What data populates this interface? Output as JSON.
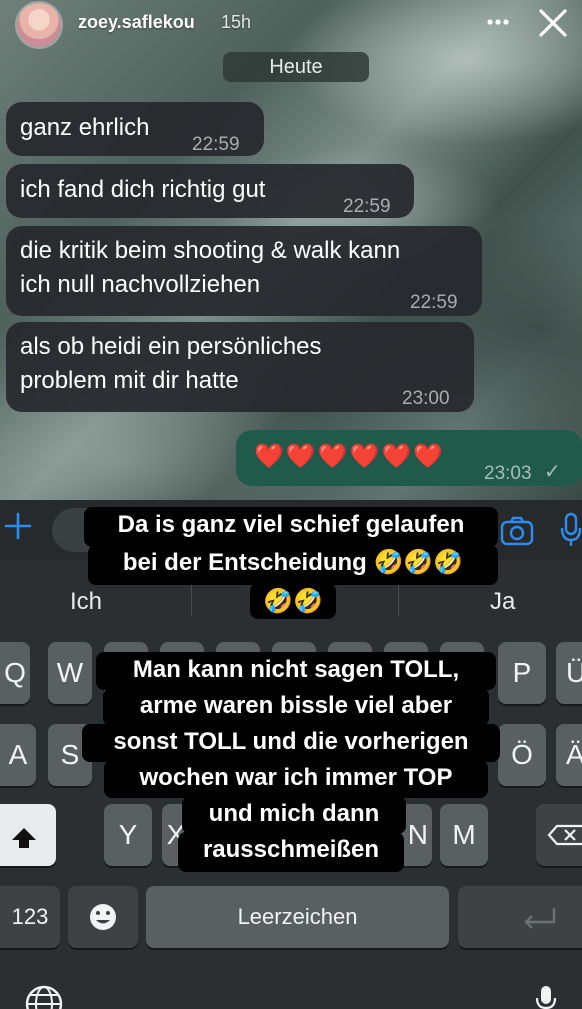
{
  "story": {
    "username": "zoey.saflekou",
    "time_ago": "15h",
    "more_icon": "more-horizontal-icon",
    "close_icon": "close-icon"
  },
  "chat": {
    "date_label": "Heute",
    "messages": [
      {
        "text": "ganz ehrlich",
        "time": "22:59"
      },
      {
        "text": "ich fand dich richtig gut",
        "time": "22:59"
      },
      {
        "text_line1": "die kritik beim shooting & walk kann",
        "text_line2": "ich null nachvollziehen",
        "time": "22:59"
      },
      {
        "text_line1": "als ob heidi ein persönliches",
        "text_line2": "problem mit dir hatte",
        "time": "23:00"
      },
      {
        "text": "❤️❤️❤️❤️❤️❤️",
        "time": "23:03",
        "status": "✓"
      }
    ]
  },
  "composer": {
    "plus_icon": "plus-icon",
    "camera_icon": "camera-icon",
    "mic_icon": "microphone-icon"
  },
  "keyboard": {
    "suggestions": [
      "Ich",
      "Ja"
    ],
    "row1": [
      "Q",
      "W",
      "P",
      "Ü"
    ],
    "row2": [
      "A",
      "S",
      "Ö",
      "Ä"
    ],
    "row3": [
      "Y",
      "X",
      "N",
      "M"
    ],
    "numbers_key": "123",
    "space_key": "Leerzeichen",
    "emoji_icon": "emoji-icon",
    "shift_icon": "shift-icon",
    "backspace_icon": "backspace-icon",
    "return_icon": "return-icon",
    "globe_icon": "globe-icon",
    "dictation_icon": "microphone-icon"
  },
  "captions": {
    "top_line1": "Da is ganz viel schief gelaufen",
    "top_line2": "bei der Entscheidung 🤣🤣🤣",
    "top_line3": "🤣🤣",
    "bottom_line1": "Man kann nicht sagen TOLL,",
    "bottom_line2": "arme waren bissle viel aber",
    "bottom_line3": "sonst TOLL und die vorherigen",
    "bottom_line4": "wochen war ich immer TOP",
    "bottom_line5": "und mich dann",
    "bottom_line6": "rausschmeißen"
  }
}
